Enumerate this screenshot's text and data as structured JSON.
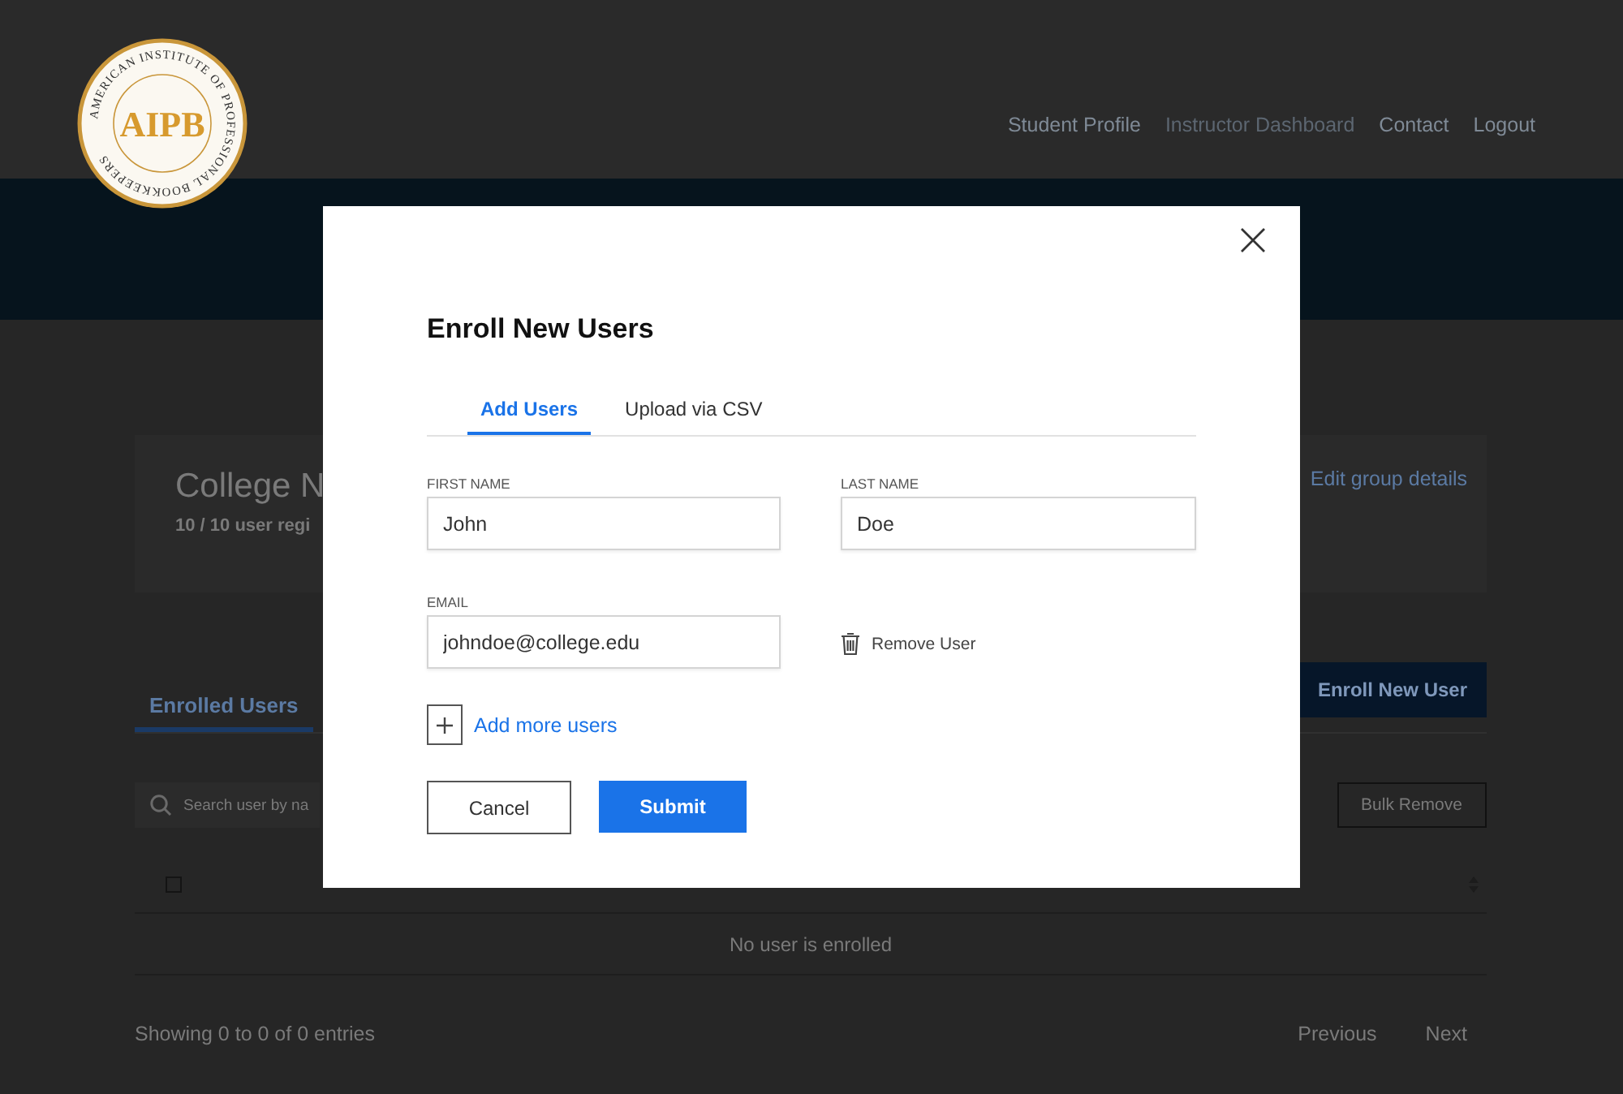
{
  "header": {
    "logo": {
      "wordmark": "AIPB",
      "ring_text": "AMERICAN INSTITUTE OF PROFESSIONAL BOOKKEEPERS"
    },
    "nav": [
      {
        "label": "Student Profile",
        "selected": false
      },
      {
        "label": "Instructor Dashboard",
        "selected": true
      },
      {
        "label": "Contact",
        "selected": false
      },
      {
        "label": "Logout",
        "selected": false
      }
    ]
  },
  "group": {
    "title": "College N",
    "subtitle": "10 / 10 user regi",
    "edit_link": "Edit group details"
  },
  "tabs": [
    {
      "label": "Enrolled Users",
      "selected": true
    }
  ],
  "enroll_button": "Enroll New User",
  "search": {
    "placeholder": "Search user by na"
  },
  "bulk_remove_button": "Bulk Remove",
  "table": {
    "header_checkbox": {
      "checked": false
    },
    "empty_message": "No user is enrolled"
  },
  "footer": {
    "info": "Showing 0 to 0 of 0 entries",
    "pagination": [
      "Previous",
      "Next"
    ]
  },
  "modal": {
    "title": "Enroll New Users",
    "tabs": [
      {
        "label": "Add Users",
        "selected": true
      },
      {
        "label": "Upload via CSV",
        "selected": false
      }
    ],
    "fields": [
      {
        "label": "FIRST NAME",
        "value": "John"
      },
      {
        "label": "LAST NAME",
        "value": "Doe"
      },
      {
        "label": "EMAIL",
        "value": "johndoe@college.edu"
      }
    ],
    "remove_user": "Remove User",
    "add_more": "Add more users",
    "cancel_button": "Cancel",
    "submit_button": "Submit"
  }
}
